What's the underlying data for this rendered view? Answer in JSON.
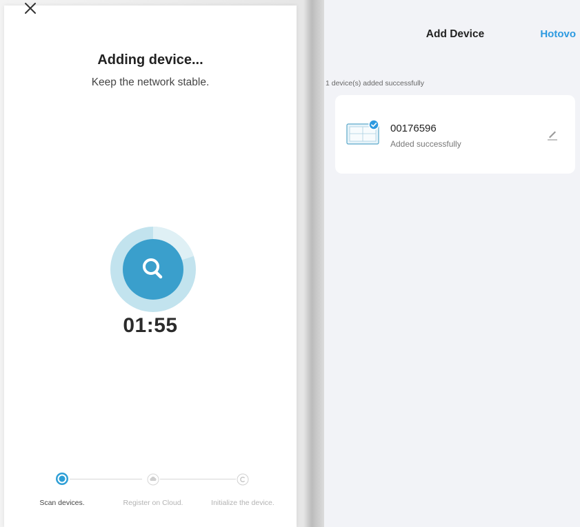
{
  "left_panel": {
    "title": "Adding device...",
    "subtitle": "Keep the network stable.",
    "timer": "01:55",
    "icons": {
      "close": "close-icon",
      "scan": "search-icon"
    },
    "steps": [
      {
        "label": "Scan devices.",
        "state": "active",
        "icon": "scan-step-icon"
      },
      {
        "label": "Register on Cloud.",
        "state": "inactive",
        "icon": "cloud-icon"
      },
      {
        "label": "Initialize the device.",
        "state": "inactive",
        "icon": "copyright-icon"
      }
    ]
  },
  "right_panel": {
    "header": {
      "title": "Add Device",
      "action": "Hotovo"
    },
    "added_count": "1 device(s) added successfully",
    "device": {
      "name": "00176596",
      "status": "Added successfully",
      "icons": {
        "thumbnail": "device-panel-icon",
        "check": "check-badge-icon",
        "edit": "edit-pencil-icon"
      }
    }
  },
  "colors": {
    "accent": "#2d9ae0",
    "scan_inner": "#3a9fcc",
    "scan_outer": "#b6dde9",
    "background_right": "#f2f3f7"
  }
}
